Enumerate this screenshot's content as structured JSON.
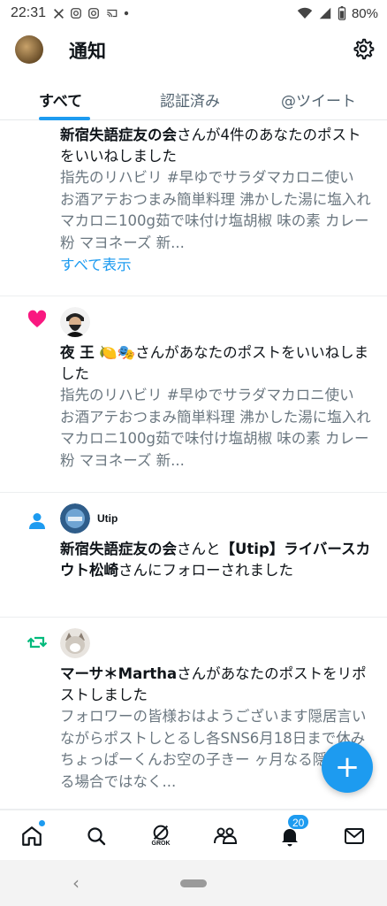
{
  "status_bar": {
    "time": "22:31",
    "battery": "80%",
    "left_icons": [
      "x-logo-icon",
      "instagram-icon",
      "instagram-icon",
      "cast-icon",
      "dot-icon"
    ],
    "right_icons": [
      "wifi-icon",
      "signal-icon",
      "battery-icon"
    ]
  },
  "header": {
    "title": "通知",
    "settings_icon": "gear-icon"
  },
  "tabs": [
    {
      "label": "すべて",
      "active": true
    },
    {
      "label": "認証済み",
      "active": false
    },
    {
      "label": "@ツイート",
      "active": false
    }
  ],
  "notifications": [
    {
      "kind": "like",
      "actor": "新宿失語症友の会",
      "action": "さんが4件のあなたのポストをいいねしました",
      "snippet": "指先のリハビリ #早ゆでサラダマカロニ使い お酒アテおつまみ簡単料理 沸かした湯に塩入れマカロニ100g茹で味付け塩胡椒 味の素 カレー粉 マヨネーズ 新...",
      "show_all": "すべて表示"
    },
    {
      "kind": "like",
      "actor": "夜 王",
      "actor_emoji": "🍋🎭",
      "action": "さんがあなたのポストをいいねしました",
      "snippet": "指先のリハビリ #早ゆでサラダマカロニ使い お酒アテおつまみ簡単料理 沸かした湯に塩入れマカロニ100g茹で味付け塩胡椒 味の素 カレー粉 マヨネーズ 新..."
    },
    {
      "kind": "follow",
      "avatar_label": "Utip",
      "actor": "新宿失語症友の会",
      "connector": "さんと",
      "actor2": "【Utip】ライバースカウト松崎",
      "action": "さんにフォローされました"
    },
    {
      "kind": "repost",
      "actor": "マーサ＊Martha",
      "action": "さんがあなたのポストをリポストしました",
      "snippet": "フォロワーの皆様おはようございます隠居言いながらポストしとるし各SNS6月18日まで休みちょっぱーくんお空の子きー ヶ月なる隠居しとる場合ではなく..."
    }
  ],
  "fab": {
    "label": "+"
  },
  "bottom_nav": {
    "items": [
      {
        "name": "home-icon"
      },
      {
        "name": "search-icon"
      },
      {
        "name": "grok-icon",
        "label": "GROK"
      },
      {
        "name": "communities-icon"
      },
      {
        "name": "notifications-icon",
        "badge": "20"
      },
      {
        "name": "messages-icon"
      }
    ]
  },
  "colors": {
    "accent": "#1d9bf0",
    "like": "#f91880",
    "repost": "#00ba7c",
    "follow": "#1d9bf0"
  }
}
